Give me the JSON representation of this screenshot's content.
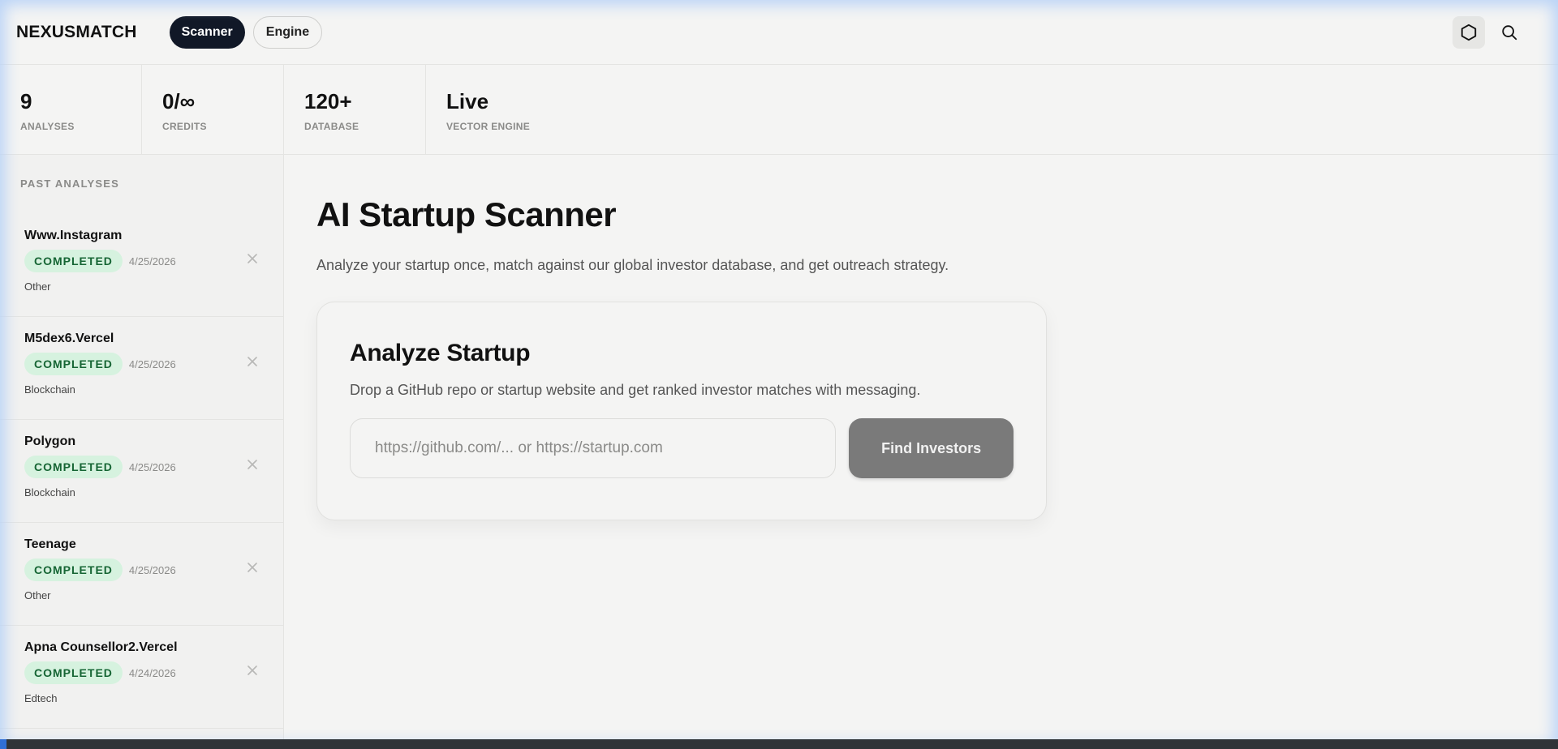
{
  "brand": "NEXUSMATCH",
  "nav": {
    "scanner": "Scanner",
    "engine": "Engine"
  },
  "stats": [
    {
      "value": "9",
      "label": "ANALYSES"
    },
    {
      "value": "0/∞",
      "label": "CREDITS"
    },
    {
      "value": "120+",
      "label": "DATABASE"
    },
    {
      "value": "Live",
      "label": "VECTOR ENGINE"
    }
  ],
  "sidebar": {
    "title": "PAST ANALYSES",
    "items": [
      {
        "name": "Www.Instagram",
        "status": "COMPLETED",
        "date": "4/25/2026",
        "category": "Other"
      },
      {
        "name": "M5dex6.Vercel",
        "status": "COMPLETED",
        "date": "4/25/2026",
        "category": "Blockchain"
      },
      {
        "name": "Polygon",
        "status": "COMPLETED",
        "date": "4/25/2026",
        "category": "Blockchain"
      },
      {
        "name": "Teenage",
        "status": "COMPLETED",
        "date": "4/25/2026",
        "category": "Other"
      },
      {
        "name": "Apna Counsellor2.Vercel",
        "status": "COMPLETED",
        "date": "4/24/2026",
        "category": "Edtech"
      }
    ]
  },
  "main": {
    "title": "AI Startup Scanner",
    "subtitle": "Analyze your startup once, match against our global investor database, and get outreach strategy.",
    "card": {
      "title": "Analyze Startup",
      "subtitle": "Drop a GitHub repo or startup website and get ranked investor matches with messaging.",
      "input_placeholder": "https://github.com/... or https://startup.com",
      "input_value": "",
      "button_label": "Find Investors"
    }
  },
  "colors": {
    "accent": "#111827",
    "badge_bg": "#d6f2df",
    "badge_text": "#166534",
    "button": "#7a7a7a"
  },
  "icons": {
    "hexagon": "hexagon-icon",
    "search": "search-icon",
    "close": "close-icon"
  }
}
